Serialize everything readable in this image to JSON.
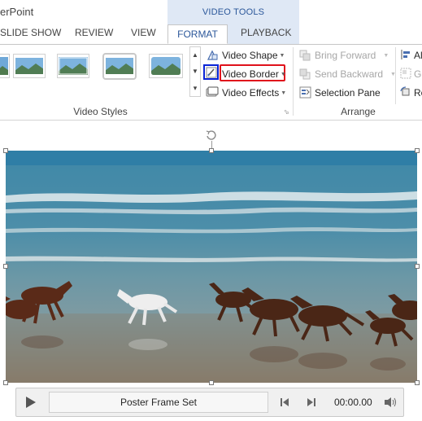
{
  "window": {
    "title_fragment": "erPoint"
  },
  "contextual_tab_group": {
    "label": "VIDEO TOOLS"
  },
  "tabs": [
    {
      "label": "SLIDE SHOW"
    },
    {
      "label": "REVIEW"
    },
    {
      "label": "VIEW"
    },
    {
      "label": "FORMAT",
      "active": true
    },
    {
      "label": "PLAYBACK"
    }
  ],
  "video_styles": {
    "group_label": "Video Styles",
    "commands": {
      "video_shape": "Video Shape",
      "video_border": "Video Border",
      "video_effects": "Video Effects"
    },
    "highlight_colors": {
      "border_icon_box": "#0a24d6",
      "border_label_box": "#e0121c"
    }
  },
  "arrange": {
    "group_label": "Arrange",
    "commands": {
      "bring_forward": "Bring Forward",
      "send_backward": "Send Backward",
      "selection_pane": "Selection Pane",
      "al": "Al",
      "gr": "Gr",
      "ro": "Ro"
    }
  },
  "player": {
    "status": "Poster Frame Set",
    "time": "00:00.00"
  },
  "icons": [
    "play-icon",
    "step-back-icon",
    "step-forward-icon",
    "volume-icon",
    "rotate-handle-icon"
  ],
  "accent_color": "#2b579a"
}
